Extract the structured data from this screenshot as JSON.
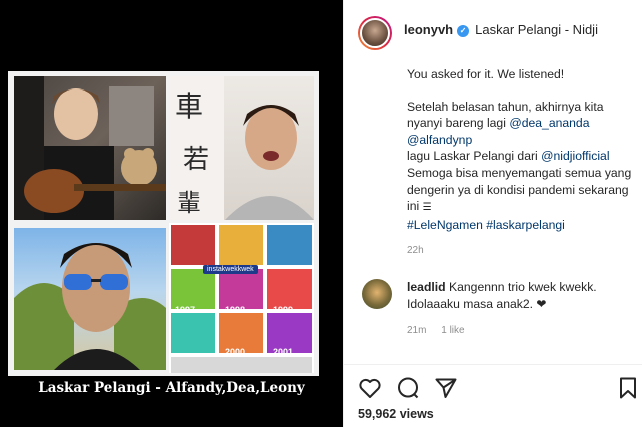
{
  "post": {
    "username": "leonyvh",
    "song": "Laskar Pelangi - Nidji",
    "caption": {
      "line1": "You asked for it. We listened!",
      "para2": "Setelah belasan tahun, akhirnya kita nyanyi bareng lagi",
      "mention1": "@dea_ananda",
      "mention2": "@alfandynp",
      "para3": "lagu Laskar Pelangi dari",
      "mention3": "@nidjiofficial",
      "para4": "Semoga bisa menyemangati semua yang dengerin ya di kondisi pandemi sekarang ini",
      "hashtags": "#LeleNgamen #laskarpelangi"
    },
    "time_ago": "22h",
    "views": "59,962 views"
  },
  "media": {
    "caption": "Laskar Pelangi - Alfandy,Dea,Leony",
    "collage_badge": "instakwekkwek",
    "years": [
      "1997",
      "1998",
      "1999",
      "2000",
      "2001"
    ]
  },
  "comment": {
    "username": "leadlid",
    "text": "Kangennn trio kwek kwekk. Idolaaaku masa anak2. ❤",
    "time_ago": "21m",
    "likes": "1 like"
  },
  "icons": [
    "verified-icon",
    "heart-icon",
    "comment-icon",
    "share-icon",
    "bookmark-icon"
  ],
  "colors": {
    "link": "#00376b",
    "verified": "#3897f0",
    "muted": "#8e8e8e"
  }
}
